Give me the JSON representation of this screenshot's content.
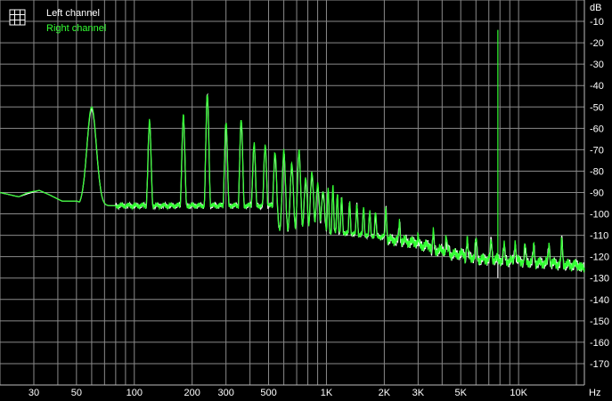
{
  "chart_data": {
    "type": "line",
    "title": "",
    "xlabel": "",
    "ylabel": "",
    "x_scale": "log",
    "x_unit": "Hz",
    "y_unit": "dB",
    "xlim": [
      20,
      22000
    ],
    "ylim": [
      -180,
      0
    ],
    "grid": true,
    "legend_position": "top-left",
    "x_ticks": [
      {
        "value": 30,
        "label": "30"
      },
      {
        "value": 50,
        "label": "50"
      },
      {
        "value": 100,
        "label": "100"
      },
      {
        "value": 200,
        "label": "200"
      },
      {
        "value": 300,
        "label": "300"
      },
      {
        "value": 500,
        "label": "500"
      },
      {
        "value": 1000,
        "label": "1K"
      },
      {
        "value": 2000,
        "label": "2K"
      },
      {
        "value": 3000,
        "label": "3K"
      },
      {
        "value": 5000,
        "label": "5K"
      },
      {
        "value": 10000,
        "label": "10K"
      }
    ],
    "x_unit_label": "Hz",
    "y_unit_label": "dB",
    "y_ticks": [
      -10,
      -20,
      -30,
      -40,
      -50,
      -60,
      -70,
      -80,
      -90,
      -100,
      -110,
      -120,
      -130,
      -140,
      -150,
      -160,
      -170
    ],
    "fundamental_hz": 60,
    "series": [
      {
        "name": "Left channel",
        "color": "#ffffff",
        "baseline": [
          [
            20,
            -90
          ],
          [
            25,
            -92
          ],
          [
            28,
            -90.5
          ],
          [
            32,
            -89
          ],
          [
            36,
            -91
          ],
          [
            42,
            -94
          ],
          [
            50,
            -94
          ],
          [
            70,
            -98
          ],
          [
            85,
            -100
          ],
          [
            100,
            -101
          ],
          [
            150,
            -104
          ],
          [
            200,
            -106
          ],
          [
            300,
            -107
          ],
          [
            500,
            -108
          ],
          [
            800,
            -110
          ],
          [
            1000,
            -111
          ],
          [
            1500,
            -112
          ],
          [
            2000,
            -113
          ],
          [
            3000,
            -117
          ],
          [
            4000,
            -120
          ],
          [
            5000,
            -121
          ],
          [
            7000,
            -122
          ],
          [
            10000,
            -123
          ],
          [
            15000,
            -124
          ],
          [
            20000,
            -128
          ],
          [
            22000,
            -131
          ]
        ],
        "peaks": [
          [
            60,
            -51
          ],
          [
            120,
            -58
          ],
          [
            180,
            -55
          ],
          [
            240,
            -45
          ],
          [
            300,
            -58
          ],
          [
            360,
            -57
          ],
          [
            420,
            -68
          ],
          [
            480,
            -69
          ],
          [
            540,
            -72
          ],
          [
            600,
            -72
          ],
          [
            660,
            -78
          ],
          [
            720,
            -72
          ],
          [
            780,
            -85
          ],
          [
            840,
            -82
          ],
          [
            900,
            -87
          ],
          [
            960,
            -90
          ],
          [
            1020,
            -89
          ],
          [
            1080,
            -88
          ],
          [
            1140,
            -91
          ],
          [
            1200,
            -93
          ],
          [
            1320,
            -95
          ],
          [
            1440,
            -96
          ],
          [
            1560,
            -98
          ],
          [
            1680,
            -100
          ],
          [
            1800,
            -100
          ],
          [
            2040,
            -98
          ],
          [
            2400,
            -105
          ],
          [
            3000,
            -112
          ],
          [
            3600,
            -110
          ],
          [
            4200,
            -112
          ],
          [
            5400,
            -113
          ],
          [
            6000,
            -113
          ],
          [
            7200,
            -113
          ],
          [
            8400,
            -116
          ],
          [
            9600,
            -114
          ],
          [
            10800,
            -116
          ],
          [
            12000,
            -116
          ],
          [
            14400,
            -115
          ],
          [
            16800,
            -113
          ]
        ],
        "spur": [
          7800,
          -130
        ]
      },
      {
        "name": "Right channel",
        "color": "#33ff33",
        "baseline": [
          [
            20,
            -90
          ],
          [
            25,
            -92
          ],
          [
            28,
            -90
          ],
          [
            32,
            -89
          ],
          [
            36,
            -91
          ],
          [
            42,
            -94
          ],
          [
            50,
            -94
          ],
          [
            70,
            -98
          ],
          [
            85,
            -100
          ],
          [
            100,
            -101
          ],
          [
            150,
            -104
          ],
          [
            200,
            -106
          ],
          [
            300,
            -107
          ],
          [
            500,
            -108
          ],
          [
            800,
            -110
          ],
          [
            1000,
            -111
          ],
          [
            1500,
            -112
          ],
          [
            2000,
            -113
          ],
          [
            3000,
            -117
          ],
          [
            4000,
            -120
          ],
          [
            5000,
            -121
          ],
          [
            7000,
            -122
          ],
          [
            10000,
            -123
          ],
          [
            15000,
            -124
          ],
          [
            20000,
            -128
          ],
          [
            22000,
            -132
          ]
        ],
        "peaks": [
          [
            60,
            -50
          ],
          [
            120,
            -57
          ],
          [
            180,
            -54
          ],
          [
            240,
            -44
          ],
          [
            300,
            -57
          ],
          [
            360,
            -56
          ],
          [
            420,
            -67
          ],
          [
            480,
            -68
          ],
          [
            540,
            -71
          ],
          [
            600,
            -71
          ],
          [
            660,
            -77
          ],
          [
            720,
            -71
          ],
          [
            780,
            -84
          ],
          [
            840,
            -81
          ],
          [
            900,
            -86
          ],
          [
            960,
            -89
          ],
          [
            1020,
            -88
          ],
          [
            1080,
            -87
          ],
          [
            1140,
            -90
          ],
          [
            1200,
            -92
          ],
          [
            1320,
            -94
          ],
          [
            1440,
            -95
          ],
          [
            1560,
            -97
          ],
          [
            1680,
            -99
          ],
          [
            1800,
            -99
          ],
          [
            2040,
            -97
          ],
          [
            2400,
            -104
          ],
          [
            3000,
            -111
          ],
          [
            3600,
            -109
          ],
          [
            4200,
            -111
          ],
          [
            5400,
            -112
          ],
          [
            6000,
            -112
          ],
          [
            7200,
            -112
          ],
          [
            8400,
            -115
          ],
          [
            9600,
            -113
          ],
          [
            10800,
            -115
          ],
          [
            12000,
            -115
          ],
          [
            14400,
            -114
          ],
          [
            16800,
            -112
          ]
        ],
        "spur": [
          7800,
          -14
        ]
      }
    ]
  }
}
